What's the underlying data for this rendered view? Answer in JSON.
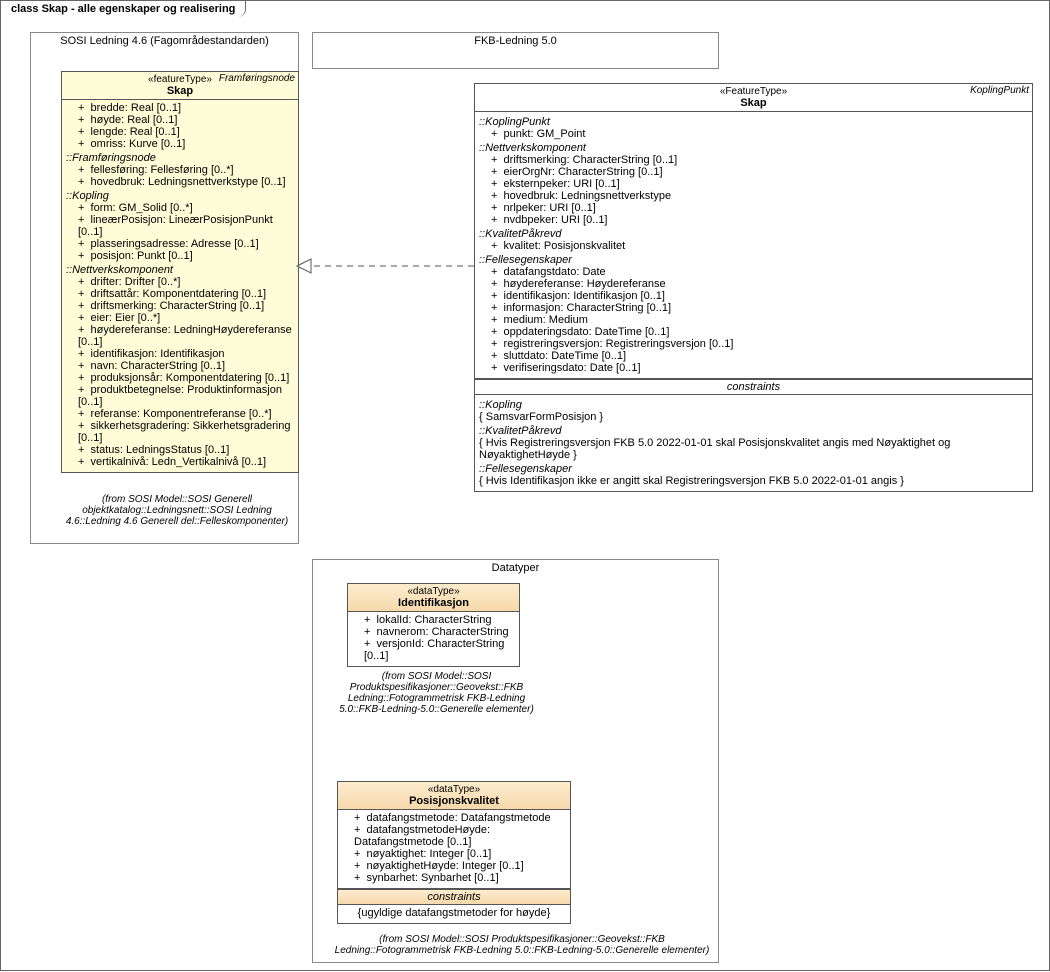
{
  "diagram": {
    "tab_prefix": "class ",
    "tab_title": "Skap - alle egenskaper og realisering"
  },
  "pkg_sosi": {
    "title": "SOSI Ledning 4.6 (Fagområdestandarden)"
  },
  "pkg_fkb": {
    "title": "FKB-Ledning 5.0"
  },
  "pkg_dt": {
    "title": "Datatyper"
  },
  "skap_sosi": {
    "note": "Framføringsnode",
    "stereo": "«featureType»",
    "name": "Skap",
    "top_attrs": [
      "bredde: Real [0..1]",
      "høyde: Real [0..1]",
      "lengde: Real [0..1]",
      "omriss: Kurve [0..1]"
    ],
    "grp1_head": "::Framføringsnode",
    "grp1": [
      "fellesføring: Fellesføring [0..*]",
      "hovedbruk: Ledningsnettverkstype [0..1]"
    ],
    "grp2_head": "::Kopling",
    "grp2": [
      "form: GM_Solid [0..*]",
      "lineærPosisjon: LineærPosisjonPunkt [0..1]",
      "plasseringsadresse: Adresse [0..1]",
      "posisjon: Punkt [0..1]"
    ],
    "grp3_head": "::Nettverkskomponent",
    "grp3": [
      "drifter: Drifter [0..*]",
      "driftsattår: Komponentdatering [0..1]",
      "driftsmerking: CharacterString [0..1]",
      "eier: Eier [0..*]",
      "høydereferanse: LedningHøydereferanse [0..1]",
      "identifikasjon: Identifikasjon",
      "navn: CharacterString [0..1]",
      "produksjonsår: Komponentdatering [0..1]",
      "produktbetegnelse: Produktinformasjon [0..1]",
      "referanse: Komponentreferanse [0..*]",
      "sikkerhetsgradering: Sikkerhetsgradering [0..1]",
      "status: LedningsStatus [0..1]",
      "vertikalnivå: Ledn_Vertikalnivå [0..1]"
    ],
    "source": "(from SOSI Model::SOSI Generell objektkatalog::Ledningsnett::SOSI Ledning 4.6::Ledning 4.6 Generell del::Felleskomponenter)"
  },
  "skap_fkb": {
    "note": "KoplingPunkt",
    "stereo": "«FeatureType»",
    "name": "Skap",
    "grp1_head": "::KoplingPunkt",
    "grp1": [
      "punkt: GM_Point"
    ],
    "grp2_head": "::Nettverkskomponent",
    "grp2": [
      "driftsmerking: CharacterString [0..1]",
      "eierOrgNr: CharacterString [0..1]",
      "eksternpeker: URI [0..1]",
      "hovedbruk: Ledningsnettverkstype",
      "nrlpeker: URI [0..1]",
      "nvdbpeker: URI [0..1]"
    ],
    "grp3_head": "::KvalitetPåkrevd",
    "grp3": [
      "kvalitet: Posisjonskvalitet"
    ],
    "grp4_head": "::Fellesegenskaper",
    "grp4": [
      "datafangstdato: Date",
      "høydereferanse: Høydereferanse",
      "identifikasjon: Identifikasjon [0..1]",
      "informasjon: CharacterString [0..1]",
      "medium: Medium",
      "oppdateringsdato: DateTime [0..1]",
      "registreringsversjon: Registreringsversjon [0..1]",
      "sluttdato: DateTime [0..1]",
      "verifiseringsdato: Date [0..1]"
    ],
    "constraints_title": "constraints",
    "c1_head": "::Kopling",
    "c1": "{ SamsvarFormPosisjon }",
    "c2_head": "::KvalitetPåkrevd",
    "c2": "{ Hvis Registreringsversjon FKB 5.0 2022-01-01 skal Posisjonskvalitet angis med Nøyaktighet og NøyaktighetHøyde }",
    "c3_head": "::Fellesegenskaper",
    "c3": "{ Hvis Identifikasjon ikke er angitt skal Registreringsversjon FKB 5.0 2022-01-01 angis }"
  },
  "ident": {
    "stereo": "«dataType»",
    "name": "Identifikasjon",
    "attrs": [
      "lokalId: CharacterString",
      "navnerom: CharacterString",
      "versjonId: CharacterString [0..1]"
    ],
    "source": "(from SOSI Model::SOSI Produktspesifikasjoner::Geovekst::FKB Ledning::Fotogrammetrisk FKB-Ledning 5.0::FKB-Ledning-5.0::Generelle elementer)"
  },
  "poskval": {
    "stereo": "«dataType»",
    "name": "Posisjonskvalitet",
    "attrs": [
      "datafangstmetode: Datafangstmetode",
      "datafangstmetodeHøyde: Datafangstmetode [0..1]",
      "nøyaktighet: Integer [0..1]",
      "nøyaktighetHøyde: Integer [0..1]",
      "synbarhet: Synbarhet [0..1]"
    ],
    "constraints_title": "constraints",
    "constraint": "{ugyldige datafangstmetoder for høyde}",
    "source": "(from SOSI Model::SOSI Produktspesifikasjoner::Geovekst::FKB Ledning::Fotogrammetrisk FKB-Ledning 5.0::FKB-Ledning-5.0::Generelle elementer)"
  }
}
